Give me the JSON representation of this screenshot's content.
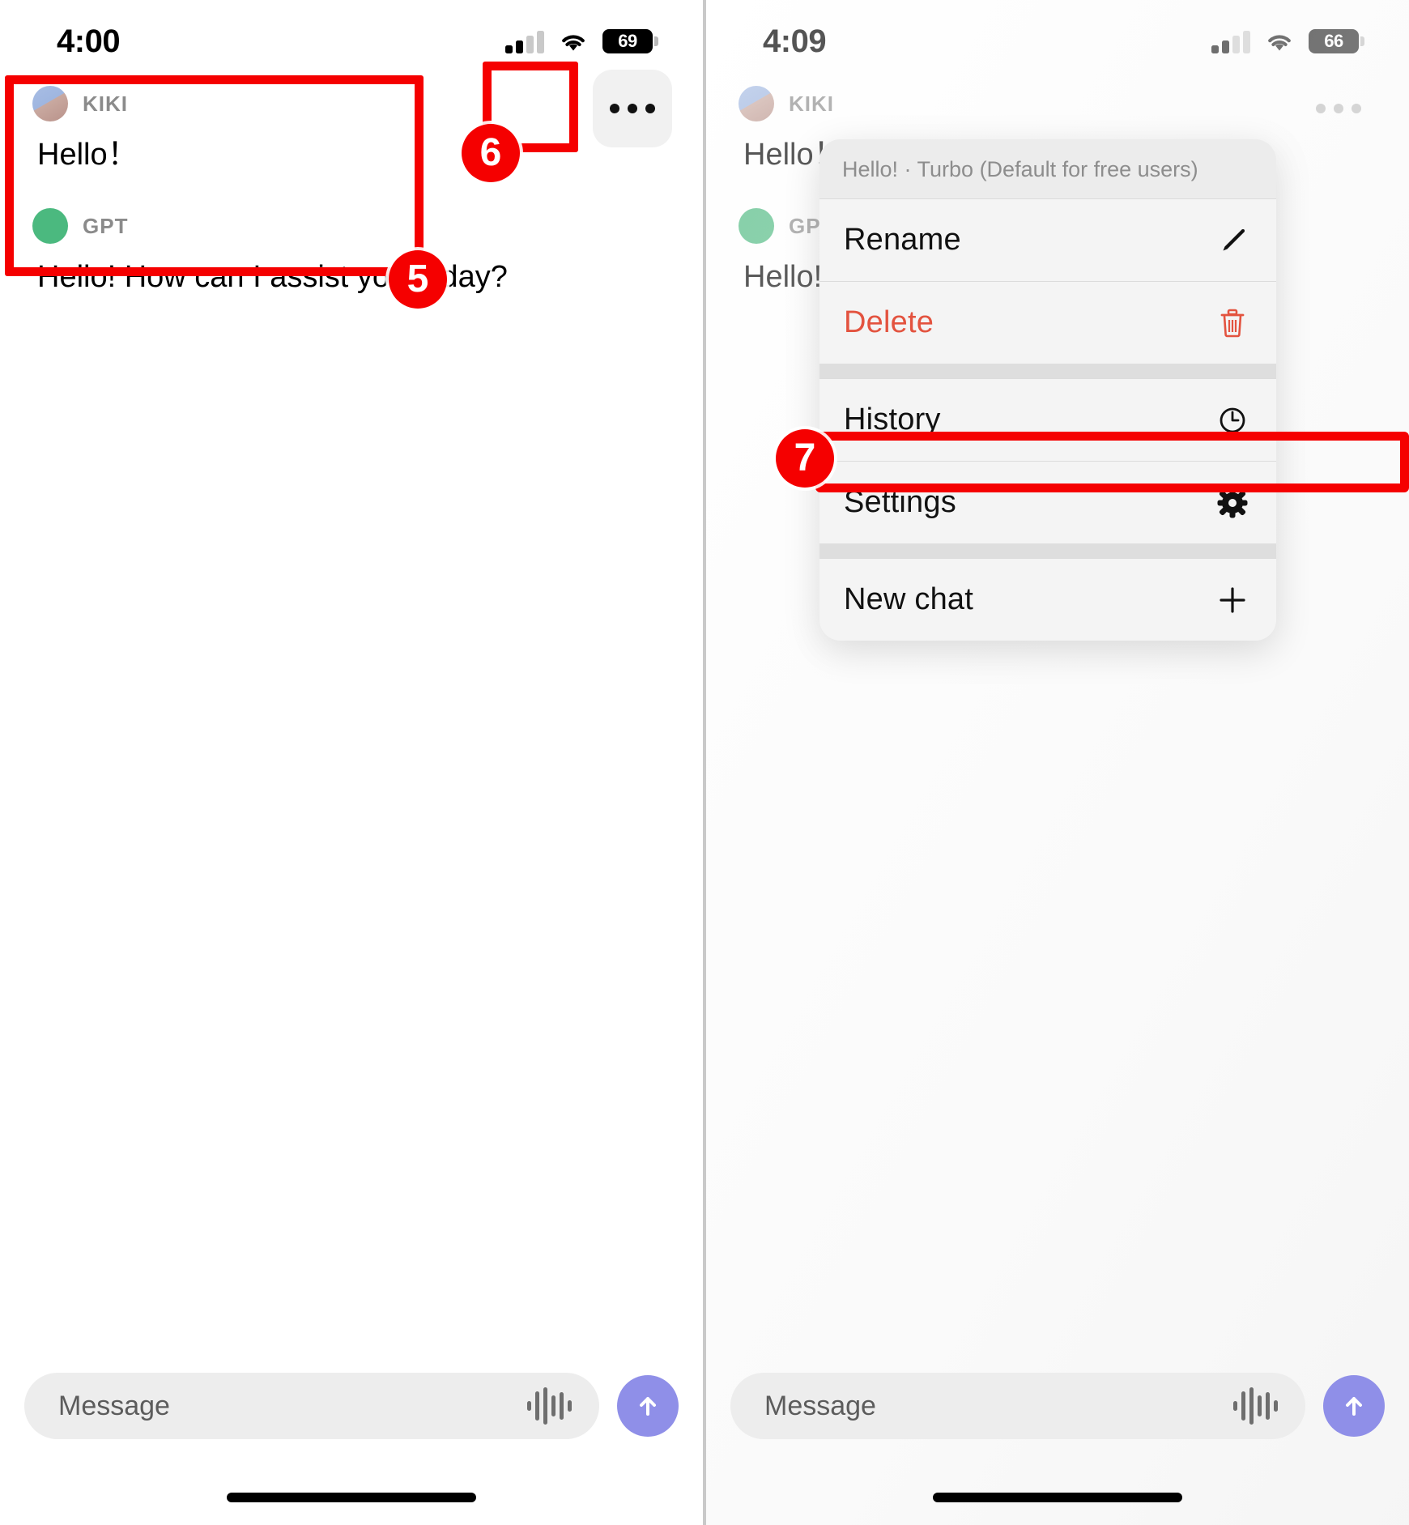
{
  "meta": {
    "app": "ChatGPT iOS chat app",
    "accent_red": "#f50000",
    "send_button_color": "#8f8fe8",
    "delete_color": "#e3533f",
    "gpt_avatar_color": "#4bb97f"
  },
  "left_panel": {
    "status": {
      "time": "4:00",
      "battery_percent": "69",
      "signal_icon": "cellular-signal-icon",
      "wifi_icon": "wifi-icon",
      "battery_icon": "battery-icon"
    },
    "more_button": {
      "name": "more-options-button",
      "icon": "ellipsis-icon"
    },
    "messages": [
      {
        "author": "KIKI",
        "avatar": "kiki-avatar",
        "text": "Hello！"
      },
      {
        "author": "GPT",
        "avatar": "gpt-avatar",
        "text": "Hello! How can I assist you today?"
      }
    ],
    "input": {
      "placeholder": "Message",
      "value": "",
      "waveform_icon": "audio-waveform-icon",
      "send_icon": "arrow-up-icon"
    }
  },
  "right_panel": {
    "status": {
      "time": "4:09",
      "battery_percent": "66",
      "signal_icon": "cellular-signal-icon",
      "wifi_icon": "wifi-icon",
      "battery_icon": "battery-icon"
    },
    "more_button": {
      "name": "more-options-button",
      "icon": "ellipsis-icon"
    },
    "messages": [
      {
        "author": "KIKI",
        "avatar": "kiki-avatar",
        "text": "Hello！"
      },
      {
        "author": "GPT",
        "avatar": "gpt-avatar",
        "text": "Hello! How can I a"
      }
    ],
    "context_menu": {
      "header": "Hello! · Turbo (Default for free users)",
      "items": [
        {
          "label": "Rename",
          "icon": "pencil-icon",
          "style": "normal"
        },
        {
          "label": "Delete",
          "icon": "trash-icon",
          "style": "danger"
        },
        {
          "label": "History",
          "icon": "clock-icon",
          "style": "normal"
        },
        {
          "label": "Settings",
          "icon": "gear-icon",
          "style": "normal"
        },
        {
          "label": "New chat",
          "icon": "plus-icon",
          "style": "normal"
        }
      ]
    },
    "input": {
      "placeholder": "Message",
      "value": "",
      "waveform_icon": "audio-waveform-icon",
      "send_icon": "arrow-up-icon"
    }
  },
  "annotations": {
    "step5": "5",
    "step6": "6",
    "step7": "7"
  }
}
